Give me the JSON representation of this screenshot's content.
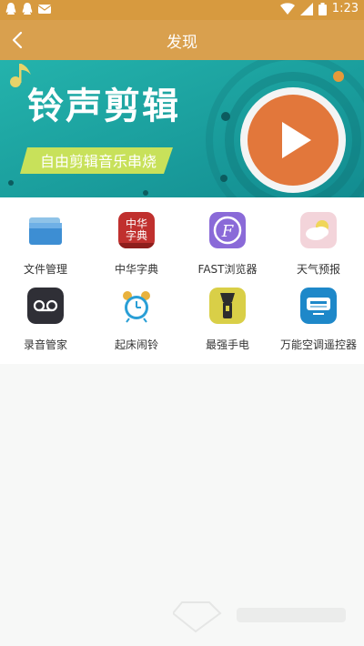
{
  "status_bar": {
    "time": "1:23",
    "left_icons": [
      "qq-icon",
      "qq-icon",
      "message-icon"
    ],
    "right_icons": [
      "wifi-icon",
      "signal-icon",
      "battery-icon"
    ]
  },
  "app_bar": {
    "title": "发现",
    "back_icon": "back-arrow-icon"
  },
  "banner": {
    "headline": "铃声剪辑",
    "subline": "自由剪辑音乐串烧",
    "colors": {
      "background": "#1aa3a1",
      "ribbon": "#c8e15a",
      "play": "#e2773b"
    }
  },
  "apps": [
    {
      "label": "文件管理",
      "icon": "folder-icon"
    },
    {
      "label": "中华字典",
      "icon": "dictionary-icon",
      "icon_text": "中华字典"
    },
    {
      "label": "FAST浏览器",
      "icon": "browser-icon",
      "icon_text": "F"
    },
    {
      "label": "天气预报",
      "icon": "weather-icon"
    },
    {
      "label": "录音管家",
      "icon": "recorder-icon"
    },
    {
      "label": "起床闹铃",
      "icon": "alarm-clock-icon"
    },
    {
      "label": "最强手电",
      "icon": "flashlight-icon"
    },
    {
      "label": "万能空调遥控器",
      "icon": "ac-remote-icon"
    }
  ]
}
